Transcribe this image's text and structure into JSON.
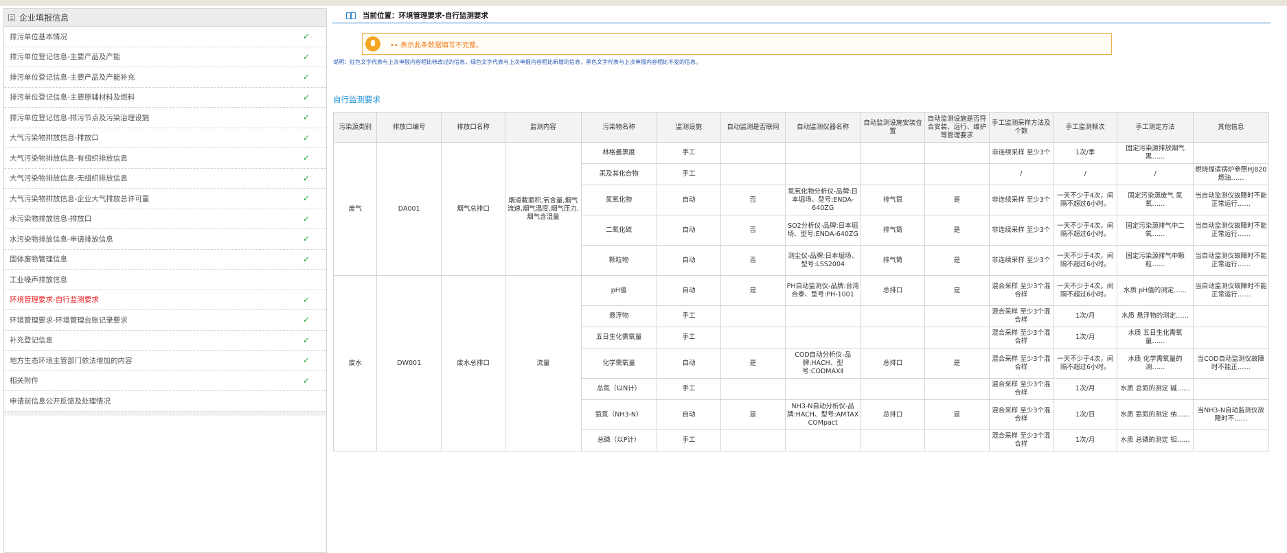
{
  "sidebar": {
    "title": "企业填报信息",
    "items": [
      {
        "label": "排污单位基本情况",
        "done": true,
        "active": false
      },
      {
        "label": "排污单位登记信息-主要产品及产能",
        "done": true,
        "active": false
      },
      {
        "label": "排污单位登记信息-主要产品及产能补充",
        "done": true,
        "active": false
      },
      {
        "label": "排污单位登记信息-主要原辅材料及燃料",
        "done": true,
        "active": false
      },
      {
        "label": "排污单位登记信息-排污节点及污染治理设施",
        "done": true,
        "active": false
      },
      {
        "label": "大气污染物排放信息-排放口",
        "done": true,
        "active": false
      },
      {
        "label": "大气污染物排放信息-有组织排放信息",
        "done": true,
        "active": false
      },
      {
        "label": "大气污染物排放信息-无组织排放信息",
        "done": true,
        "active": false
      },
      {
        "label": "大气污染物排放信息-企业大气排放总许可量",
        "done": true,
        "active": false
      },
      {
        "label": "水污染物排放信息-排放口",
        "done": true,
        "active": false
      },
      {
        "label": "水污染物排放信息-申请排放信息",
        "done": true,
        "active": false
      },
      {
        "label": "固体废物管理信息",
        "done": true,
        "active": false
      },
      {
        "label": "工业噪声排放信息",
        "done": false,
        "active": false
      },
      {
        "label": "环境管理要求-自行监测要求",
        "done": true,
        "active": true
      },
      {
        "label": "环境管理要求-环境管理台账记录要求",
        "done": true,
        "active": false
      },
      {
        "label": "补充登记信息",
        "done": true,
        "active": false
      },
      {
        "label": "地方生态环境主管部门依法增加的内容",
        "done": true,
        "active": false
      },
      {
        "label": "相关附件",
        "done": true,
        "active": false
      },
      {
        "label": "申请前信息公开反馈及处理情况",
        "done": false,
        "active": false
      }
    ]
  },
  "breadcrumb": "当前位置：环境管理要求-自行监测要求",
  "notice": "•• 表示此条数据填写不完整。",
  "explanation": "说明：红色文字代表与上次申报内容相比修改过的信息，绿色文字代表与上次申报内容相比新增的信息，黑色文字代表与上次申报内容相比不变的信息。",
  "section_title": "自行监测要求",
  "table": {
    "headers": [
      "污染源类别",
      "排放口编号",
      "排放口名称",
      "监测内容",
      "污染物名称",
      "监测设施",
      "自动监测是否联网",
      "自动监测仪器名称",
      "自动监测设施安装位置",
      "自动监测设施是否符合安装、运行、维护等管理要求",
      "手工监测采样方法及个数",
      "手工监测频次",
      "手工测定方法",
      "其他信息"
    ],
    "groups": [
      {
        "category": "废气",
        "outlet_code": "DA001",
        "outlet_name": "烟气总排口",
        "content": "烟道截面积,氧含量,烟气流速,烟气温度,烟气压力,烟气含湿量",
        "rows": [
          [
            "林格曼黑度",
            "手工",
            "",
            "",
            "",
            "",
            "非连续采样 至少3个",
            "1次/季",
            "固定污染源排放烟气黑……",
            ""
          ],
          [
            "汞及其化合物",
            "手工",
            "",
            "",
            "",
            "",
            "/",
            "/",
            "/",
            "燃烧煤适锅炉参照HJ820燃油……"
          ],
          [
            "氮氧化物",
            "自动",
            "否",
            "氮氧化物分析仪-品牌:日本堀场、型号:ENDA-640ZG",
            "排气筒",
            "是",
            "非连续采样 至少3个",
            "一天不少于4次，间隔不超过6小时。",
            "固定污染源废气 氮氧……",
            "当自动监测仪故障时不能正常运行……"
          ],
          [
            "二氧化硫",
            "自动",
            "否",
            "SO2分析仪-品牌:日本堀场、型号:ENDA-640ZG",
            "排气筒",
            "是",
            "非连续采样 至少3个",
            "一天不少于4次，间隔不超过6小时。",
            "固定污染源排气中二氧……",
            "当自动监测仪故障时不能正常运行……"
          ],
          [
            "颗粒物",
            "自动",
            "否",
            "测尘仪-品牌:日本堀场、型号:LSS2004",
            "排气筒",
            "是",
            "非连续采样 至少3个",
            "一天不少于4次，间隔不超过6小时。",
            "固定污染源排气中颗粒……",
            "当自动监测仪故障时不能正常运行……"
          ]
        ]
      },
      {
        "category": "废水",
        "outlet_code": "DW001",
        "outlet_name": "废水总排口",
        "content": "流量",
        "rows": [
          [
            "pH值",
            "自动",
            "是",
            "PH自动监测仪-品牌:台湾合泰、型号:PH-1001",
            "总排口",
            "是",
            "混合采样 至少3个混合样",
            "一天不少于4次，间隔不超过6小时。",
            "水质 pH值的测定……",
            "当自动监测仪故障时不能正常运行……"
          ],
          [
            "悬浮物",
            "手工",
            "",
            "",
            "",
            "",
            "混合采样 至少3个混合样",
            "1次/月",
            "水质 悬浮物的测定……",
            ""
          ],
          [
            "五日生化需氧量",
            "手工",
            "",
            "",
            "",
            "",
            "混合采样 至少3个混合样",
            "1次/月",
            "水质 五日生化需氧量……",
            ""
          ],
          [
            "化学需氧量",
            "自动",
            "是",
            "COD自动分析仪-品牌:HACH、型号:CODMAXⅡ",
            "总排口",
            "是",
            "混合采样 至少3个混合样",
            "一天不少于4次，间隔不超过6小时。",
            "水质 化学需氧量的测……",
            "当COD自动监测仪故障时不能正……"
          ],
          [
            "总氮（以N计）",
            "手工",
            "",
            "",
            "",
            "",
            "混合采样 至少3个混合样",
            "1次/月",
            "水质 总氮的测定 碱……",
            ""
          ],
          [
            "氨氮（NH3-N）",
            "自动",
            "是",
            "NH3-N自动分析仪-品牌:HACH、型号:AMTAX COMpact",
            "总排口",
            "是",
            "混合采样 至少3个混合样",
            "1次/日",
            "水质 氨氮的测定 纳……",
            "当NH3-N自动监测仪故障时不……"
          ],
          [
            "总磷（以P计）",
            "手工",
            "",
            "",
            "",
            "",
            "混合采样 至少3个混合样",
            "1次/月",
            "水质 总磷的测定 钼……",
            ""
          ]
        ]
      }
    ]
  }
}
